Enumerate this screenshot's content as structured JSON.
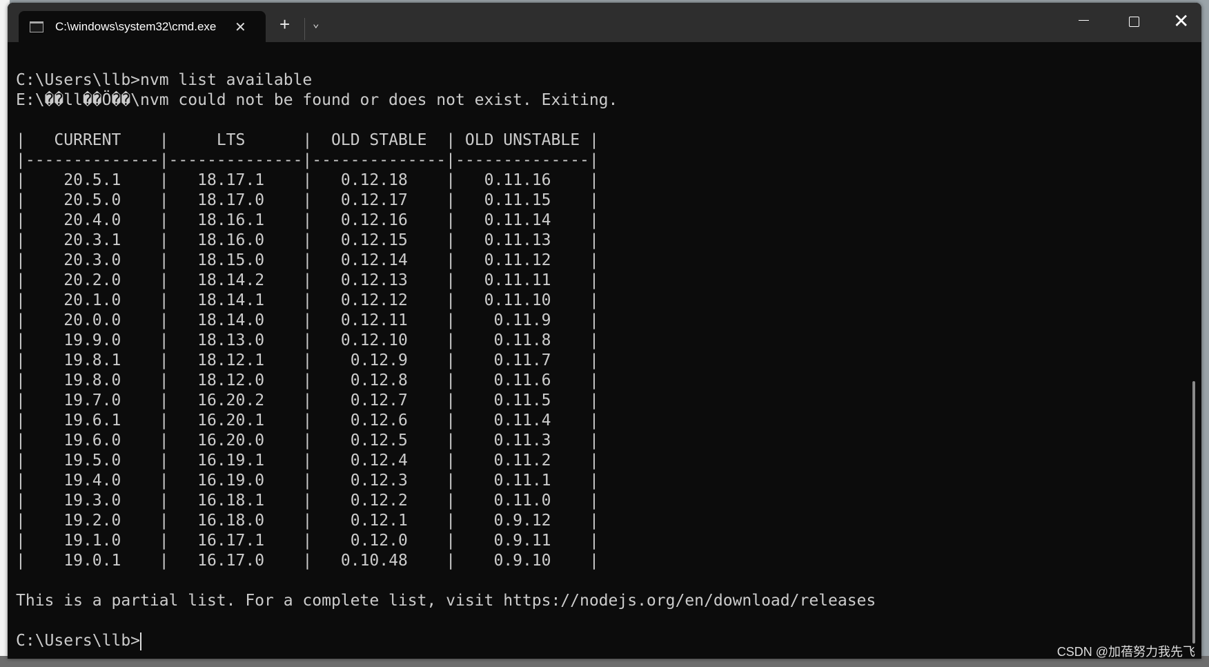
{
  "window": {
    "tab_title": "C:\\windows\\system32\\cmd.exe",
    "new_tab_label": "+",
    "tab_close_icon": "close-icon",
    "dropdown_icon": "chevron-down-icon"
  },
  "terminal": {
    "command_line": "C:\\Users\\llb>nvm list available",
    "error_line": "E:\\��ll��Ö��\\nvm could not be found or does not exist. Exiting.",
    "table": {
      "headers": [
        "CURRENT",
        "LTS",
        "OLD STABLE",
        "OLD UNSTABLE"
      ],
      "rows": [
        [
          "20.5.1",
          "18.17.1",
          "0.12.18",
          "0.11.16"
        ],
        [
          "20.5.0",
          "18.17.0",
          "0.12.17",
          "0.11.15"
        ],
        [
          "20.4.0",
          "18.16.1",
          "0.12.16",
          "0.11.14"
        ],
        [
          "20.3.1",
          "18.16.0",
          "0.12.15",
          "0.11.13"
        ],
        [
          "20.3.0",
          "18.15.0",
          "0.12.14",
          "0.11.12"
        ],
        [
          "20.2.0",
          "18.14.2",
          "0.12.13",
          "0.11.11"
        ],
        [
          "20.1.0",
          "18.14.1",
          "0.12.12",
          "0.11.10"
        ],
        [
          "20.0.0",
          "18.14.0",
          "0.12.11",
          "0.11.9"
        ],
        [
          "19.9.0",
          "18.13.0",
          "0.12.10",
          "0.11.8"
        ],
        [
          "19.8.1",
          "18.12.1",
          "0.12.9",
          "0.11.7"
        ],
        [
          "19.8.0",
          "18.12.0",
          "0.12.8",
          "0.11.6"
        ],
        [
          "19.7.0",
          "16.20.2",
          "0.12.7",
          "0.11.5"
        ],
        [
          "19.6.1",
          "16.20.1",
          "0.12.6",
          "0.11.4"
        ],
        [
          "19.6.0",
          "16.20.0",
          "0.12.5",
          "0.11.3"
        ],
        [
          "19.5.0",
          "16.19.1",
          "0.12.4",
          "0.11.2"
        ],
        [
          "19.4.0",
          "16.19.0",
          "0.12.3",
          "0.11.1"
        ],
        [
          "19.3.0",
          "16.18.1",
          "0.12.2",
          "0.11.0"
        ],
        [
          "19.2.0",
          "16.18.0",
          "0.12.1",
          "0.9.12"
        ],
        [
          "19.1.0",
          "16.17.1",
          "0.12.0",
          "0.9.11"
        ],
        [
          "19.0.1",
          "16.17.0",
          "0.10.48",
          "0.9.10"
        ]
      ]
    },
    "partial_note": "This is a partial list. For a complete list, visit https://nodejs.org/en/download/releases",
    "prompt": "C:\\Users\\llb>"
  },
  "watermark": "CSDN @加蓓努力我先飞"
}
